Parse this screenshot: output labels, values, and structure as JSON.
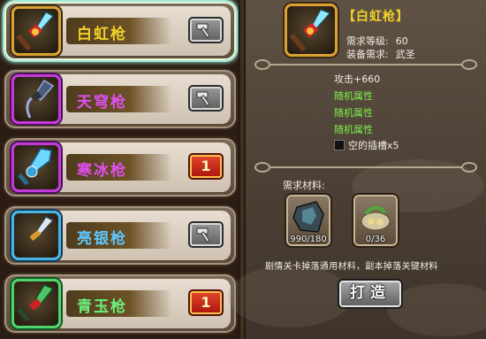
{
  "weapon_list": [
    {
      "name": "白虹枪",
      "name_color": "#f2d12a",
      "rarity": "gold",
      "selected": true,
      "action": "forge",
      "icon": "red-spear-icon"
    },
    {
      "name": "天穹枪",
      "name_color": "#e24ff0",
      "rarity": "purple",
      "selected": false,
      "action": "forge",
      "icon": "black-spear-icon"
    },
    {
      "name": "寒冰枪",
      "name_color": "#e24ff0",
      "rarity": "purple",
      "selected": false,
      "action": "count",
      "count": "1",
      "icon": "ice-spear-icon"
    },
    {
      "name": "亮银枪",
      "name_color": "#5cc8ff",
      "rarity": "blue",
      "selected": false,
      "action": "forge",
      "icon": "silver-spear-icon"
    },
    {
      "name": "青玉枪",
      "name_color": "#6cf07a",
      "rarity": "green",
      "selected": false,
      "action": "count",
      "count": "1",
      "icon": "jade-spear-icon"
    }
  ],
  "detail": {
    "title": "【白虹枪】",
    "level_req_label": "需求等级:",
    "level_req_value": "60",
    "equip_req_label": "装备需求:",
    "equip_req_value": "武圣",
    "attack": "攻击+660",
    "random_attrs": [
      "随机属性",
      "随机属性",
      "随机属性"
    ],
    "socket_text": "空的插槽x5"
  },
  "materials": {
    "label": "需求材料:",
    "items": [
      {
        "icon": "iron-ore-icon",
        "count": "990/180"
      },
      {
        "icon": "herb-bundle-icon",
        "count": "0/36"
      }
    ],
    "note": "剧情关卡掉落通用材料，副本掉落关键材料"
  },
  "forge_button": "打造",
  "colors": {
    "gold": "#f2d12a",
    "purple": "#e24ff0",
    "blue": "#5cc8ff",
    "green": "#6cf07a",
    "attr_green": "#7cf04c"
  }
}
